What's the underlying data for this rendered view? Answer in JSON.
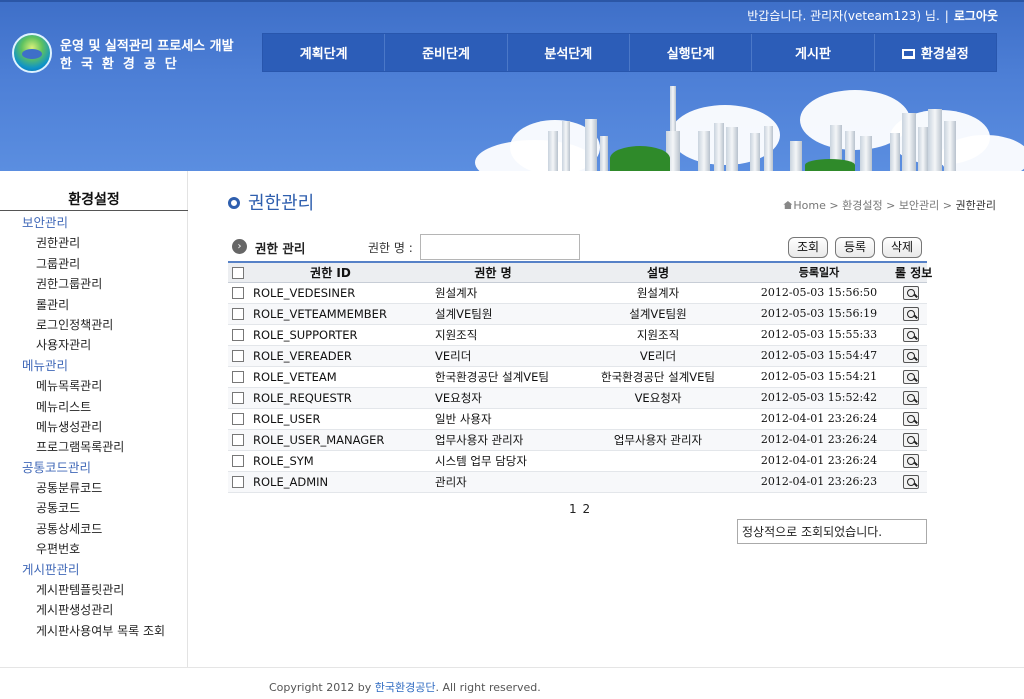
{
  "header": {
    "logo_line1": "운영 및 실적관리 프로세스 개발",
    "logo_line2": "한국환경공단",
    "greeting": "반갑습니다. 관리자(veteam123) 님.",
    "separator": "|",
    "logout": "로그아웃",
    "menu": [
      "계획단계",
      "준비단계",
      "분석단계",
      "실행단계",
      "게시판",
      "환경설정"
    ]
  },
  "sidebar": {
    "title": "환경설정",
    "groups": [
      {
        "label": "보안관리",
        "items": [
          "권한관리",
          "그룹관리",
          "권한그룹관리",
          "롤관리",
          "로그인정책관리",
          "사용자관리"
        ]
      },
      {
        "label": "메뉴관리",
        "items": [
          "메뉴목록관리",
          "메뉴리스트",
          "메뉴생성관리",
          "프로그램목록관리"
        ]
      },
      {
        "label": "공통코드관리",
        "items": [
          "공통분류코드",
          "공통코드",
          "공통상세코드",
          "우편번호"
        ]
      },
      {
        "label": "게시판관리",
        "items": [
          "게시판템플릿관리",
          "게시판생성관리",
          "게시판사용여부 목록 조회"
        ]
      }
    ]
  },
  "main": {
    "page_title": "권한관리",
    "breadcrumb": {
      "home": "Home",
      "items": [
        "환경설정",
        "보안관리"
      ],
      "current": "권한관리",
      "sep": ">"
    },
    "search": {
      "section_label": "권한 관리",
      "field_label": "권한 명 :",
      "value": "",
      "placeholder": ""
    },
    "buttons": {
      "search": "조회",
      "register": "등록",
      "delete": "삭제"
    },
    "table": {
      "headers": [
        "권한 ID",
        "권한 명",
        "설명",
        "등록일자",
        "롤 정보"
      ],
      "rows": [
        {
          "id": "ROLE_VEDESINER",
          "name": "원설계자",
          "desc": "원설계자",
          "date": "2012-05-03 15:56:50"
        },
        {
          "id": "ROLE_VETEAMMEMBER",
          "name": "설계VE팀원",
          "desc": "설계VE팀원",
          "date": "2012-05-03 15:56:19"
        },
        {
          "id": "ROLE_SUPPORTER",
          "name": "지원조직",
          "desc": "지원조직",
          "date": "2012-05-03 15:55:33"
        },
        {
          "id": "ROLE_VEREADER",
          "name": "VE리더",
          "desc": "VE리더",
          "date": "2012-05-03 15:54:47"
        },
        {
          "id": "ROLE_VETEAM",
          "name": "한국환경공단 설계VE팀",
          "desc": "한국환경공단 설계VE팀",
          "date": "2012-05-03 15:54:21"
        },
        {
          "id": "ROLE_REQUESTR",
          "name": "VE요청자",
          "desc": "VE요청자",
          "date": "2012-05-03 15:52:42"
        },
        {
          "id": "ROLE_USER",
          "name": "일반 사용자",
          "desc": "",
          "date": "2012-04-01 23:26:24"
        },
        {
          "id": "ROLE_USER_MANAGER",
          "name": "업무사용자 관리자",
          "desc": "업무사용자 관리자",
          "date": "2012-04-01 23:26:24"
        },
        {
          "id": "ROLE_SYM",
          "name": "시스템 업무 담당자",
          "desc": "",
          "date": "2012-04-01 23:26:24"
        },
        {
          "id": "ROLE_ADMIN",
          "name": "관리자",
          "desc": "",
          "date": "2012-04-01 23:26:23"
        }
      ]
    },
    "paging": [
      "1",
      "2"
    ],
    "status_message": "정상적으로 조회되었습니다."
  },
  "footer": {
    "prefix": "Copyright 2012 by",
    "org": "한국환경공단",
    "suffix": ". All right reserved."
  }
}
